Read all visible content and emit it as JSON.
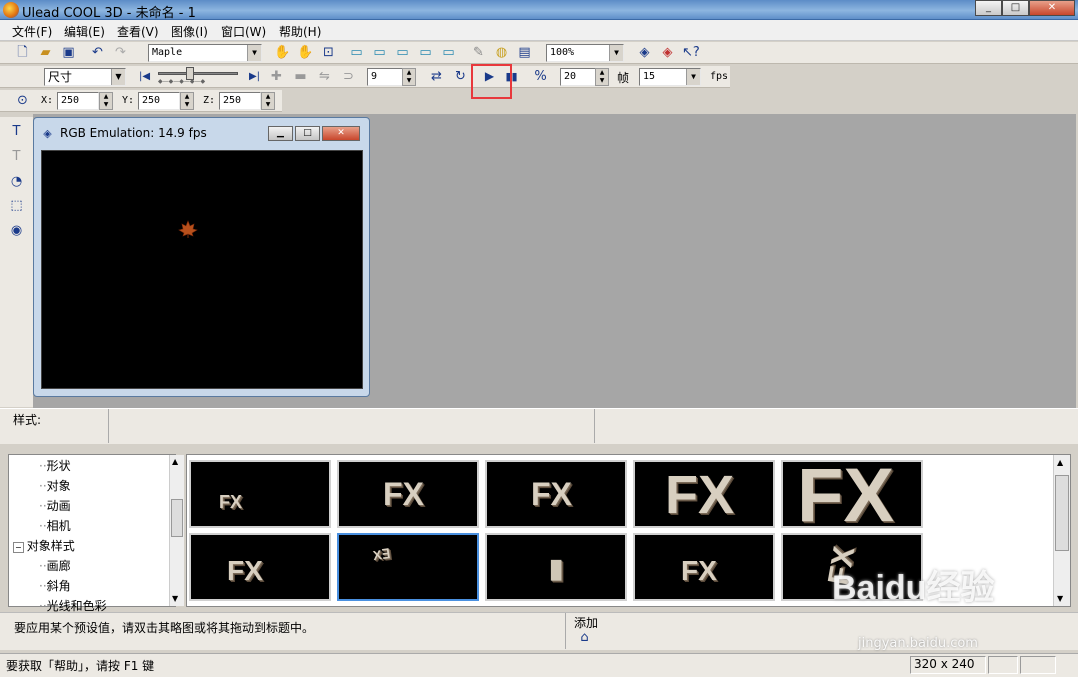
{
  "window": {
    "title": "Ulead COOL 3D - 未命名 - 1"
  },
  "menu": [
    "文件(F)",
    "编辑(E)",
    "查看(V)",
    "图像(I)",
    "窗口(W)",
    "帮助(H)"
  ],
  "toolbar1": {
    "font": "Maple",
    "zoom": "100%"
  },
  "toolbar2": {
    "size_mode": "尺寸",
    "frame_value": "9",
    "frames": "20",
    "frame_label": "帧",
    "fps_value": "15",
    "fps_label": "fps"
  },
  "toolbar3": {
    "x_label": "X:",
    "x": "250",
    "y_label": "Y:",
    "y": "250",
    "z_label": "Z:",
    "z": "250"
  },
  "preview": {
    "title": "RGB Emulation: 14.9 fps"
  },
  "style_bar": {
    "label": "样式:"
  },
  "tree": {
    "items": [
      "形状",
      "对象",
      "动画",
      "相机",
      "对象样式",
      "画廊",
      "斜角",
      "光线和色彩"
    ]
  },
  "thumbnails": [
    "FX",
    "FX",
    "FX",
    "FX",
    "FX",
    "FX",
    "X∃",
    "▮",
    "FX",
    "FX"
  ],
  "hint": {
    "text": "要应用某个预设值，请双击其略图或将其拖动到标题中。",
    "add_label": "添加"
  },
  "status": {
    "help_text": "要获取「帮助」，请按 F1 键",
    "resolution": "320 x 240"
  },
  "watermark": {
    "brand": "Baidu经验",
    "url": "jingyan.baidu.com"
  },
  "colors": {
    "highlight": "#e8383c",
    "canvas": "#a6a6a6",
    "title_gradient": "#8db6e0"
  }
}
